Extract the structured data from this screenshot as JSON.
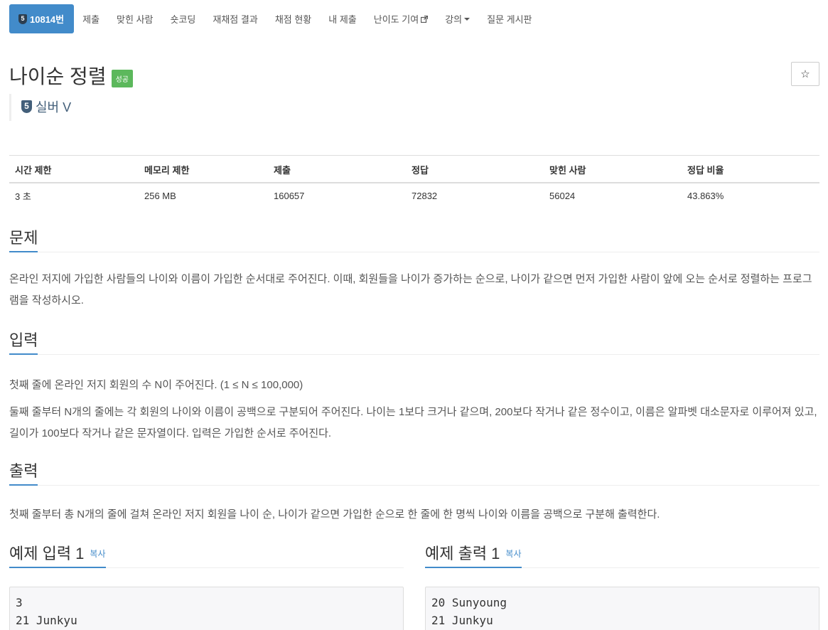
{
  "nav": {
    "problem_badge": "5",
    "problem_number": "10814번",
    "items": [
      "제출",
      "맞힌 사람",
      "숏코딩",
      "재채점 결과",
      "채점 현황",
      "내 제출",
      "난이도 기여",
      "강의",
      "질문 게시판"
    ]
  },
  "title": "나이순 정렬",
  "status_badge": "성공",
  "star": "☆",
  "tier": {
    "badge": "5",
    "label": "실버 V"
  },
  "stats": {
    "headers": [
      "시간 제한",
      "메모리 제한",
      "제출",
      "정답",
      "맞힌 사람",
      "정답 비율"
    ],
    "values": [
      "3 초",
      "256 MB",
      "160657",
      "72832",
      "56024",
      "43.863%"
    ]
  },
  "problem": {
    "heading": "문제",
    "text": "온라인 저지에 가입한 사람들의 나이와 이름이 가입한 순서대로 주어진다. 이때, 회원들을 나이가 증가하는 순으로, 나이가 같으면 먼저 가입한 사람이 앞에 오는 순서로 정렬하는 프로그램을 작성하시오."
  },
  "input": {
    "heading": "입력",
    "line1": "첫째 줄에 온라인 저지 회원의 수 N이 주어진다. (1 ≤ N ≤ 100,000)",
    "line2": "둘째 줄부터 N개의 줄에는 각 회원의 나이와 이름이 공백으로 구분되어 주어진다. 나이는 1보다 크거나 같으며, 200보다 작거나 같은 정수이고, 이름은 알파벳 대소문자로 이루어져 있고, 길이가 100보다 작거나 같은 문자열이다. 입력은 가입한 순서로 주어진다."
  },
  "output": {
    "heading": "출력",
    "text": "첫째 줄부터 총 N개의 줄에 걸쳐 온라인 저지 회원을 나이 순, 나이가 같으면 가입한 순으로 한 줄에 한 명씩 나이와 이름을 공백으로 구분해 출력한다."
  },
  "sample_input": {
    "heading": "예제 입력 1",
    "copy": "복사",
    "content": "3\n21 Junkyu"
  },
  "sample_output": {
    "heading": "예제 출력 1",
    "copy": "복사",
    "content": "20 Sunyoung\n21 Junkyu"
  }
}
